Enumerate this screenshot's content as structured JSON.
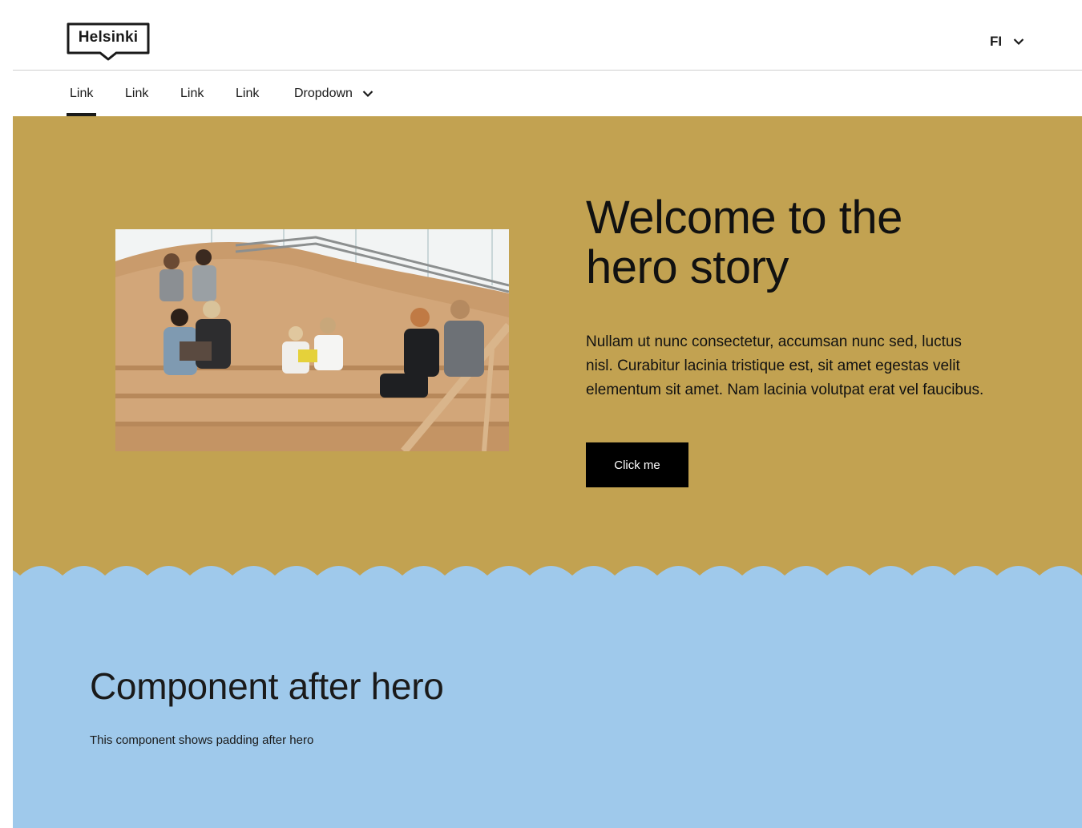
{
  "header": {
    "logo_text": "Helsinki",
    "language": "FI"
  },
  "nav": {
    "items": [
      "Link",
      "Link",
      "Link",
      "Link"
    ],
    "dropdown_label": "Dropdown"
  },
  "hero": {
    "title_line1": "Welcome to the",
    "title_line2": "hero story",
    "text": "Nullam ut nunc consectetur, accumsan nunc sed, luctus nisl. Curabitur lacinia tristique est, sit amet egestas velit elementum sit amet. Nam lacinia volutpat erat vel faucibus.",
    "button_label": "Click me",
    "background_color": "#c2a251"
  },
  "after_hero": {
    "title": "Component after hero",
    "text": "This component shows padding after hero",
    "background_color": "#9fc9eb"
  }
}
